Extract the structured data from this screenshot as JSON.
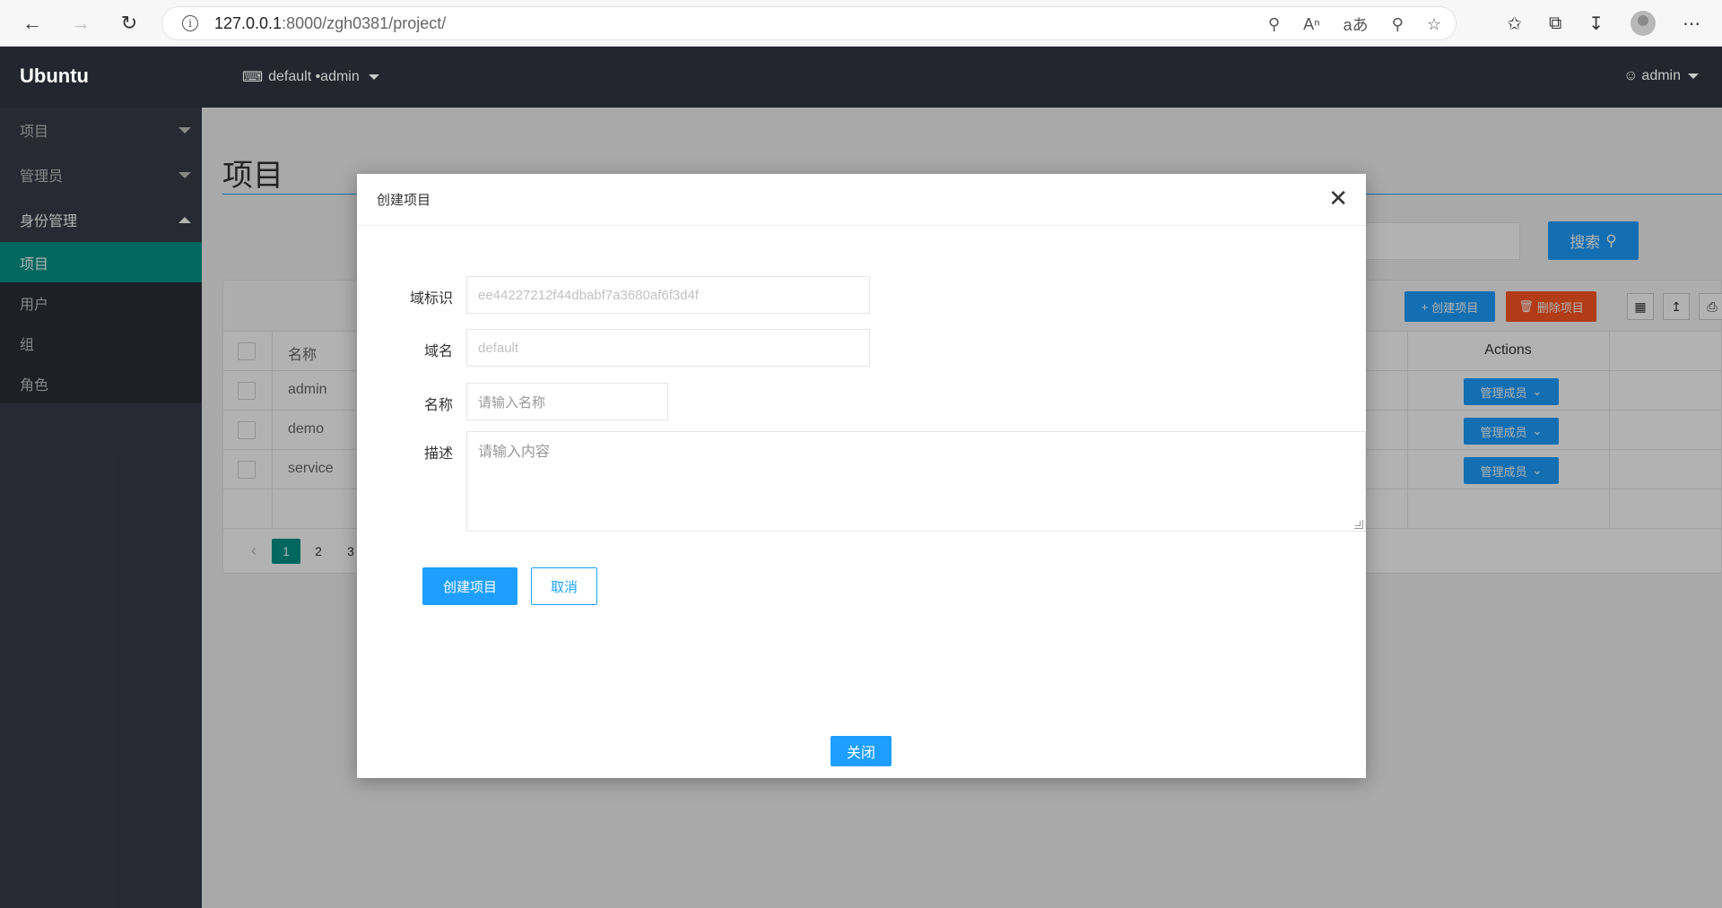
{
  "browser": {
    "url_host": "127.0.0.1",
    "url_rest": ":8000/zgh0381/project/"
  },
  "app": {
    "brand": "Ubuntu",
    "domain_selector": "default •admin",
    "user": "admin"
  },
  "sidebar": {
    "groups": [
      {
        "label": "项目"
      },
      {
        "label": "管理员"
      },
      {
        "label": "身份管理"
      }
    ],
    "items": [
      {
        "label": "项目",
        "active": true
      },
      {
        "label": "用户"
      },
      {
        "label": "组"
      },
      {
        "label": "角色"
      }
    ]
  },
  "page": {
    "title": "项目",
    "search_button": "搜索",
    "create_button": "创建项目",
    "delete_button": "删除项目"
  },
  "table": {
    "headers": {
      "name": "名称",
      "actions": "Actions"
    },
    "rows": [
      {
        "name": "admin",
        "action": "管理成员"
      },
      {
        "name": "demo",
        "action": "管理成员"
      },
      {
        "name": "service",
        "action": "管理成员"
      }
    ]
  },
  "pager": {
    "pages": [
      "1",
      "2",
      "3"
    ],
    "current": "1"
  },
  "modal": {
    "title": "创建项目",
    "fields": {
      "domain_id_label": "域标识",
      "domain_id_value": "ee44227212f44dbabf7a3680af6f3d4f",
      "domain_name_label": "域名",
      "domain_name_value": "default",
      "name_label": "名称",
      "name_placeholder": "请输入名称",
      "desc_label": "描述",
      "desc_placeholder": "请输入内容"
    },
    "submit": "创建项目",
    "cancel": "取消",
    "close": "关闭"
  },
  "colors": {
    "accent": "#1e9fff",
    "active_nav": "#009688",
    "danger": "#ff5722",
    "header_bg": "#23262e",
    "sidebar_bg": "#393d49"
  }
}
